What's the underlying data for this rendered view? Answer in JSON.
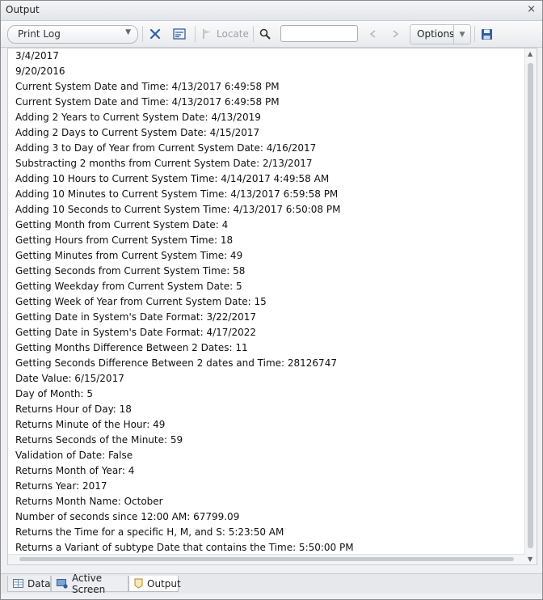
{
  "window": {
    "title": "Output",
    "close_glyph": "×"
  },
  "toolbar": {
    "filter_combo": {
      "value": "Print Log",
      "arrow_glyph": "▼"
    },
    "clear_icon": "close-x-icon",
    "wrap_icon": "word-wrap-icon",
    "locate_label": "Locate",
    "search_placeholder": "",
    "search_value": "",
    "options_label": "Options",
    "options_arrow_glyph": "▼",
    "save_icon": "floppy-disk-icon"
  },
  "log_lines": [
    "3/4/2017",
    "9/20/2016",
    "Current System Date and Time: 4/13/2017 6:49:58 PM",
    "Current System Date and Time: 4/13/2017 6:49:58 PM",
    "Adding 2 Years to Current System Date: 4/13/2019",
    "Adding 2 Days to Current System Date: 4/15/2017",
    "Adding 3 to Day of Year from Current System Date: 4/16/2017",
    "Substracting 2 months from Current System Date: 2/13/2017",
    "Adding 10 Hours to Current System Time: 4/14/2017 4:49:58 AM",
    "Adding 10 Minutes to Current System Time: 4/13/2017 6:59:58 PM",
    "Adding 10 Seconds to Current System Time: 4/13/2017 6:50:08 PM",
    "Getting Month from Current System Date: 4",
    "Getting Hours from Current System Time: 18",
    "Getting Minutes from Current System Time: 49",
    "Getting Seconds from Current System Time: 58",
    "Getting Weekday from Current System Date: 5",
    "Getting Week of Year from Current System Date: 15",
    "Getting Date in System's Date Format: 3/22/2017",
    "Getting Date in System's Date Format: 4/17/2022",
    "Getting Months Difference Between 2 Dates: 11",
    "Getting Seconds Difference Between 2 dates and Time: 28126747",
    "Date Value: 6/15/2017",
    "Day of Month: 5",
    "Returns Hour of Day: 18",
    "Returns Minute of the Hour: 49",
    "Returns Seconds of the Minute: 59",
    "Validation of Date: False",
    "Returns Month of Year: 4",
    "Returns Year: 2017",
    "Returns Month Name: October",
    "Number of seconds since 12:00 AM: 67799.09",
    "Returns the Time for a specific H, M, and S: 5:23:50 AM",
    "Returns a Variant of subtype Date that contains the Time: 5:50:00 PM"
  ],
  "tabs": [
    {
      "label": "Data",
      "icon": "data-grid-icon",
      "active": false
    },
    {
      "label": "Active Screen",
      "icon": "active-screen-icon",
      "active": false
    },
    {
      "label": "Output",
      "icon": "output-icon",
      "active": true
    }
  ],
  "colors": {
    "accent_blue": "#2f5f9e",
    "disabled_gray": "#9da2a8"
  }
}
